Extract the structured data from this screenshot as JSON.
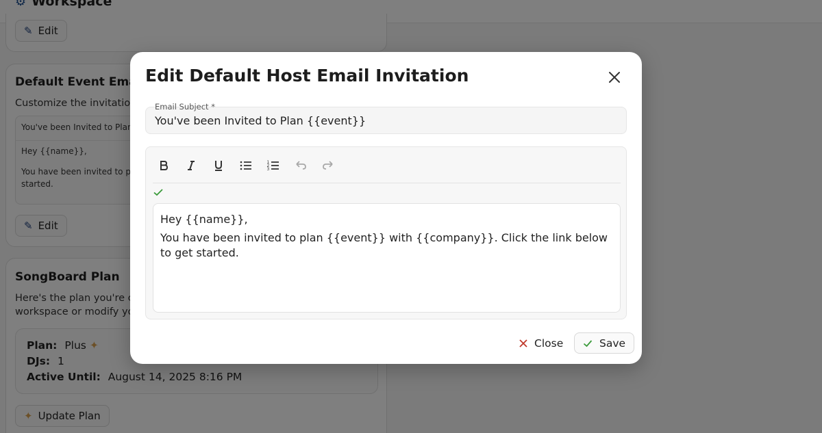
{
  "page": {
    "workspace_title": "Workspace",
    "edit_label": "Edit",
    "email_card": {
      "title": "Default Event Email I",
      "description": "Customize the invitation e",
      "preview_subject": "You've been Invited to Plan {{",
      "preview_greeting": "Hey {{name}},",
      "preview_body_line1": "You have been invited to pla",
      "preview_body_line2": "started.",
      "edit_label": "Edit"
    },
    "plan_card": {
      "title": "SongBoard Plan",
      "description_line1": "Here's the plan you're cur",
      "description_line2": "workspace or modify you",
      "plan_label": "Plan:",
      "plan_value": "Plus",
      "djs_label": "DJs:",
      "djs_value": "1",
      "active_label": "Active Until:",
      "active_value": "August 14, 2025 8:16 PM",
      "update_label": "Update Plan"
    }
  },
  "modal": {
    "title": "Edit Default Host Email Invitation",
    "subject_label": "Email Subject *",
    "subject_value": "You've been Invited to Plan {{event}}",
    "body_line1": "Hey {{name}},",
    "body_line2": "You have been invited to plan {{event}} with {{company}}. Click the link below to get started.",
    "close_label": "Close",
    "save_label": "Save"
  },
  "colors": {
    "check_green": "#3a9a3a",
    "close_red": "#c0392b",
    "accent_blue": "#1e3f7a"
  }
}
